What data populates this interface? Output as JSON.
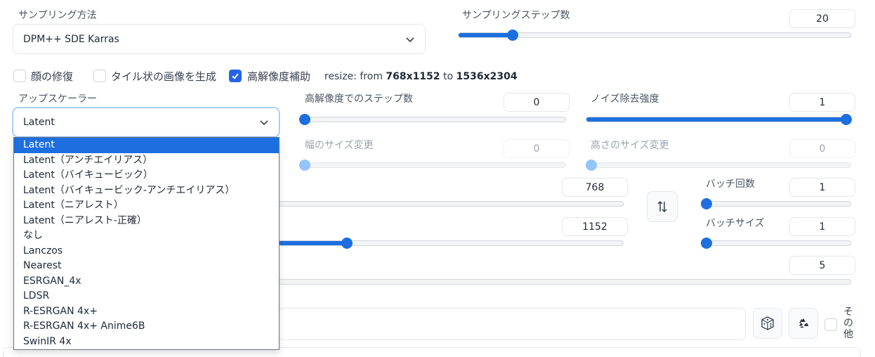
{
  "sampling": {
    "method_label": "サンプリング方法",
    "method_value": "DPM++ SDE Karras",
    "steps_label": "サンプリングステップ数",
    "steps_value": "20",
    "steps_fraction": 0.13
  },
  "options": {
    "face_restore_label": "顔の修復",
    "face_restore_checked": false,
    "tiling_label": "タイル状の画像を生成",
    "tiling_checked": false,
    "hires_fix_label": "高解像度補助",
    "hires_fix_checked": true,
    "resize_prefix": "resize: from",
    "resize_from": "768x1152",
    "resize_to_word": "to",
    "resize_to": "1536x2304"
  },
  "upscaler": {
    "label": "アップスケーラー",
    "value": "Latent",
    "options": [
      "Latent",
      "Latent（アンチエイリアス）",
      "Latent（バイキュービック）",
      "Latent（バイキュービック-アンチエイリアス）",
      "Latent（ニアレスト）",
      "Latent（ニアレスト-正確）",
      "なし",
      "Lanczos",
      "Nearest",
      "ESRGAN_4x",
      "LDSR",
      "R-ESRGAN 4x+",
      "R-ESRGAN 4x+ Anime6B",
      "SwinIR 4x"
    ],
    "selected_index": 0
  },
  "hires": {
    "steps_label": "高解像度でのステップ数",
    "steps_value": "0",
    "steps_fraction": 0.0,
    "denoise_label": "ノイズ除去強度",
    "denoise_value": "1",
    "denoise_fraction": 1.0,
    "width_label": "幅のサイズ変更",
    "width_value": "0",
    "height_label": "高さのサイズ変更",
    "height_value": "0"
  },
  "size": {
    "width_value": "768",
    "height_value": "1152",
    "swap_icon": "swap-vertical-arrows-icon"
  },
  "batch": {
    "count_label": "バッチ回数",
    "count_value": "1",
    "size_label": "バッチサイズ",
    "size_value": "1"
  },
  "cfg": {
    "value": "5"
  },
  "seed": {
    "dice_icon": "dice-icon",
    "recycle_icon": "recycle-icon",
    "extra_label": "その他"
  },
  "colors": {
    "accent": "#1d6fe0",
    "checkbox_on": "#2563eb"
  }
}
